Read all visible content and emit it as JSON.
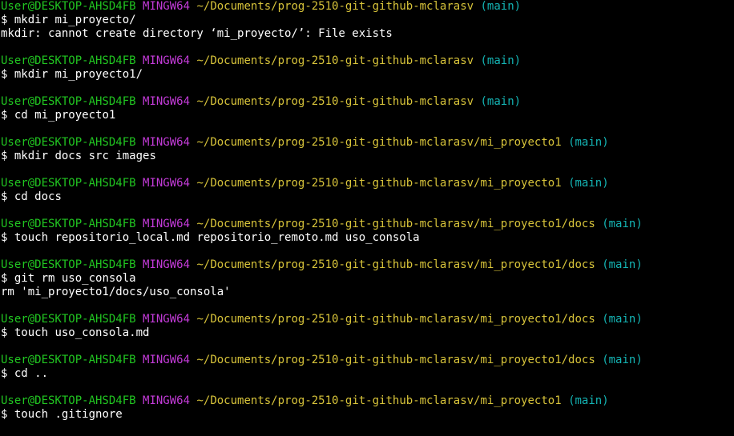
{
  "blocks": [
    {
      "user": "User@DESKTOP-AHSD4FB",
      "system": "MINGW64",
      "path": "~/Documents/prog-2510-git-github-mclarasv",
      "branch": "(main)",
      "prompt": "$",
      "command": "mkdir mi_proyecto/",
      "output": [
        "mkdir: cannot create directory ‘mi_proyecto/’: File exists"
      ]
    },
    {
      "user": "User@DESKTOP-AHSD4FB",
      "system": "MINGW64",
      "path": "~/Documents/prog-2510-git-github-mclarasv",
      "branch": "(main)",
      "prompt": "$",
      "command": "mkdir mi_proyecto1/",
      "output": []
    },
    {
      "user": "User@DESKTOP-AHSD4FB",
      "system": "MINGW64",
      "path": "~/Documents/prog-2510-git-github-mclarasv",
      "branch": "(main)",
      "prompt": "$",
      "command": "cd mi_proyecto1",
      "output": []
    },
    {
      "user": "User@DESKTOP-AHSD4FB",
      "system": "MINGW64",
      "path": "~/Documents/prog-2510-git-github-mclarasv/mi_proyecto1",
      "branch": "(main)",
      "prompt": "$",
      "command": "mkdir docs src images",
      "output": []
    },
    {
      "user": "User@DESKTOP-AHSD4FB",
      "system": "MINGW64",
      "path": "~/Documents/prog-2510-git-github-mclarasv/mi_proyecto1",
      "branch": "(main)",
      "prompt": "$",
      "command": "cd docs",
      "output": []
    },
    {
      "user": "User@DESKTOP-AHSD4FB",
      "system": "MINGW64",
      "path": "~/Documents/prog-2510-git-github-mclarasv/mi_proyecto1/docs",
      "branch": "(main)",
      "prompt": "$",
      "command": "touch repositorio_local.md repositorio_remoto.md uso_consola",
      "output": []
    },
    {
      "user": "User@DESKTOP-AHSD4FB",
      "system": "MINGW64",
      "path": "~/Documents/prog-2510-git-github-mclarasv/mi_proyecto1/docs",
      "branch": "(main)",
      "prompt": "$",
      "command": "git rm uso_consola",
      "output": [
        "rm 'mi_proyecto1/docs/uso_consola'"
      ]
    },
    {
      "user": "User@DESKTOP-AHSD4FB",
      "system": "MINGW64",
      "path": "~/Documents/prog-2510-git-github-mclarasv/mi_proyecto1/docs",
      "branch": "(main)",
      "prompt": "$",
      "command": "touch uso_consola.md",
      "output": []
    },
    {
      "user": "User@DESKTOP-AHSD4FB",
      "system": "MINGW64",
      "path": "~/Documents/prog-2510-git-github-mclarasv/mi_proyecto1/docs",
      "branch": "(main)",
      "prompt": "$",
      "command": "cd ..",
      "output": []
    },
    {
      "user": "User@DESKTOP-AHSD4FB",
      "system": "MINGW64",
      "path": "~/Documents/prog-2510-git-github-mclarasv/mi_proyecto1",
      "branch": "(main)",
      "prompt": "$",
      "command": "touch .gitignore",
      "output": []
    }
  ],
  "colors": {
    "background": "#000000",
    "user": "#21c521",
    "system": "#c33bd8",
    "path": "#d7c33a",
    "branch": "#14b4b4",
    "text": "#ffffff"
  }
}
